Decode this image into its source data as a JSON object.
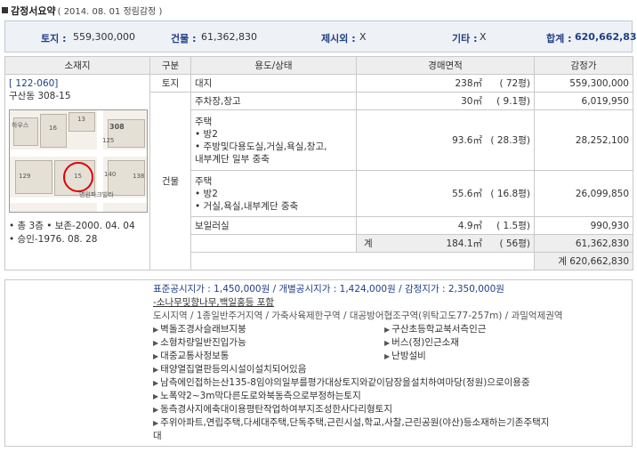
{
  "header": {
    "title": "감정서요약",
    "date": "( 2014. 08. 01   정림감정 )"
  },
  "summary": {
    "land_label": "토지 :",
    "land_value": "559,300,000",
    "building_label": "건물 :",
    "building_value": "61,362,830",
    "excluded_label": "제시외 :",
    "excluded_value": "X",
    "other_label": "기타 :",
    "other_value": "X",
    "total_label": "합계 :",
    "total_value": "620,662,830"
  },
  "table": {
    "headers": [
      "소재지",
      "구분",
      "용도/상태",
      "경매면적",
      "감정가"
    ],
    "location": {
      "code": "[ 122-060]",
      "address": "구산동 308-15",
      "bullets": [
        "• 총 3층   • 보존-2000. 04. 04",
        "• 승인-1976. 08. 28"
      ]
    },
    "map_labels": [
      "13",
      "16",
      "308",
      "125",
      "15",
      "129",
      "140",
      "138",
      "하우스",
      "명원파크빌라"
    ],
    "cat_land": "토지",
    "cat_building": "건물",
    "rows": [
      {
        "use": [
          "대지"
        ],
        "area": "238㎡",
        "pyeong": "( 72평)",
        "price": "559,300,000"
      },
      {
        "use": [
          "주차장,창고"
        ],
        "area": "30㎡",
        "pyeong": "( 9.1평)",
        "price": "6,019,950"
      },
      {
        "use": [
          "주택",
          "• 방2",
          "• 주방및다용도실,거실,욕실,창고,",
          "내부계단 일부 중축"
        ],
        "area": "93.6㎡",
        "pyeong": "( 28.3평)",
        "price": "28,252,100"
      },
      {
        "use": [
          "주택",
          "• 방2",
          "• 거실,욕실,내부계단 중축"
        ],
        "area": "55.6㎡",
        "pyeong": "( 16.8평)",
        "price": "26,099,850"
      },
      {
        "use": [
          "보일러실"
        ],
        "area": "4.9㎡",
        "pyeong": "( 1.5평)",
        "price": "990,930"
      }
    ],
    "subtotal": {
      "label": "계",
      "area": "184.1㎡",
      "pyeong": "( 56평)",
      "price": "61,362,830"
    },
    "grand_total": "계  620,662,830"
  },
  "notes": {
    "price_line": "표준공시지가 : 1,450,000원 / 개별공시지가 : 1,424,000원 / 감정지가 : 2,350,000원",
    "sub_line": "-소나무및향나무,백일홍등 포함",
    "zone_line": "도시지역 / 1종일반주거지역 / 가축사육제한구역 / 대공방어협조구역(위탁고도77-257m) / 과밀억제권역",
    "pairs": [
      [
        "벽돌조경사슬래브지붕",
        "구산초등학교북서측인근"
      ],
      [
        "소형차량일반진입가능",
        "버스(정)인근소재"
      ],
      [
        "대중교통사정보통",
        "난방설비"
      ]
    ],
    "items": [
      "태양열집열판등의시설이설치되어있음",
      "남측에인접하는산135-8임야의일부를평가대상토지와같이담장을설치하여마당(정원)으로이용중",
      "노폭약2~3m막다른도로와북동측으로부정하는토지",
      "동측경사지에축대이용평탄작업하여부지조성한사다리형토지",
      "주위아파트,연립주택,다세대주택,단독주택,근린시설,학교,사찰,근린공원(야산)등소재하는기존주택지",
      "대"
    ]
  }
}
